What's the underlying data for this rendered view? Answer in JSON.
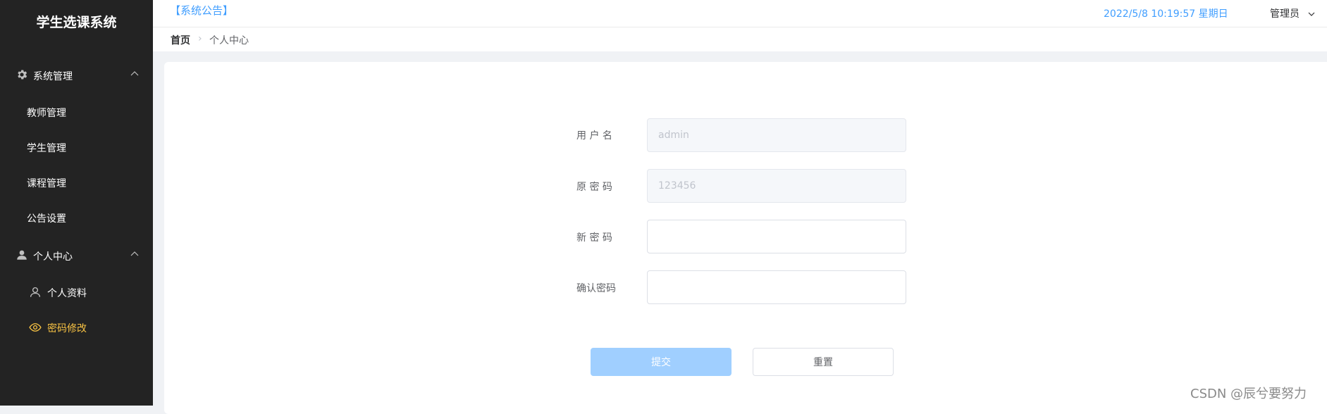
{
  "app": {
    "title": "学生选课系统"
  },
  "sidebar": {
    "groups": [
      {
        "label": "系统管理",
        "icon": "gear-icon",
        "items": [
          {
            "label": "教师管理"
          },
          {
            "label": "学生管理"
          },
          {
            "label": "课程管理"
          },
          {
            "label": "公告设置"
          }
        ]
      },
      {
        "label": "个人中心",
        "icon": "person-icon",
        "items": [
          {
            "label": "个人资料",
            "icon": "user-outline-icon"
          },
          {
            "label": "密码修改",
            "icon": "eye-icon",
            "active": true
          }
        ]
      }
    ]
  },
  "header": {
    "notice": "【系统公告】",
    "datetime": "2022/5/8 10:19:57 星期日",
    "user": "管理员"
  },
  "breadcrumb": {
    "home": "首页",
    "current": "个人中心"
  },
  "form": {
    "username": {
      "label": "用 户 名",
      "value": "admin"
    },
    "old_password": {
      "label": "原 密 码",
      "value": "123456"
    },
    "new_password": {
      "label": "新 密 码",
      "value": ""
    },
    "confirm_password": {
      "label": "确认密码",
      "value": ""
    },
    "submit_label": "提交",
    "reset_label": "重置"
  },
  "watermark": "CSDN @辰兮要努力",
  "colors": {
    "sidebar_bg": "#232323",
    "active": "#f6c143",
    "accent": "#409eff",
    "submit_disabled": "#a0cfff"
  }
}
